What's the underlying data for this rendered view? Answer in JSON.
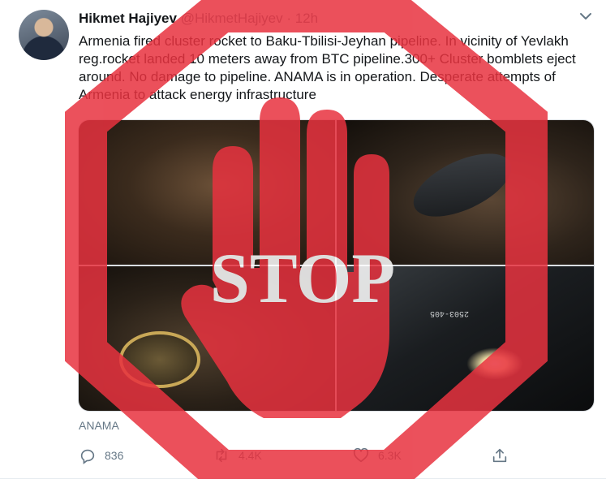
{
  "tweet": {
    "author_name": "Hikmet Hajiyev",
    "author_handle": "@HikmetHajiyev",
    "separator": "·",
    "time": "12h",
    "text": "Armenia fired cluster rocket to Baku-Tbilisi-Jeyhan pipeline. In vicinity of Yevlakh reg.rocket landed 10 meters away from BTC pipeline.300+ Cluster bomblets eject around. No damage to pipeline. ANAMA is in operation. Desperate attempts of Armenia to attack energy infrastructure",
    "media_source": "ANAMA",
    "media_stencil": "2503-405"
  },
  "actions": {
    "reply_count": "836",
    "retweet_count": "4.4K",
    "like_count": "6.3K"
  },
  "overlay": {
    "stop_label": "STOP",
    "stop_color": "#e8323f"
  },
  "icons": [
    "chevron-down-icon",
    "reply-icon",
    "retweet-icon",
    "like-icon",
    "share-icon",
    "stop-hand-icon"
  ]
}
